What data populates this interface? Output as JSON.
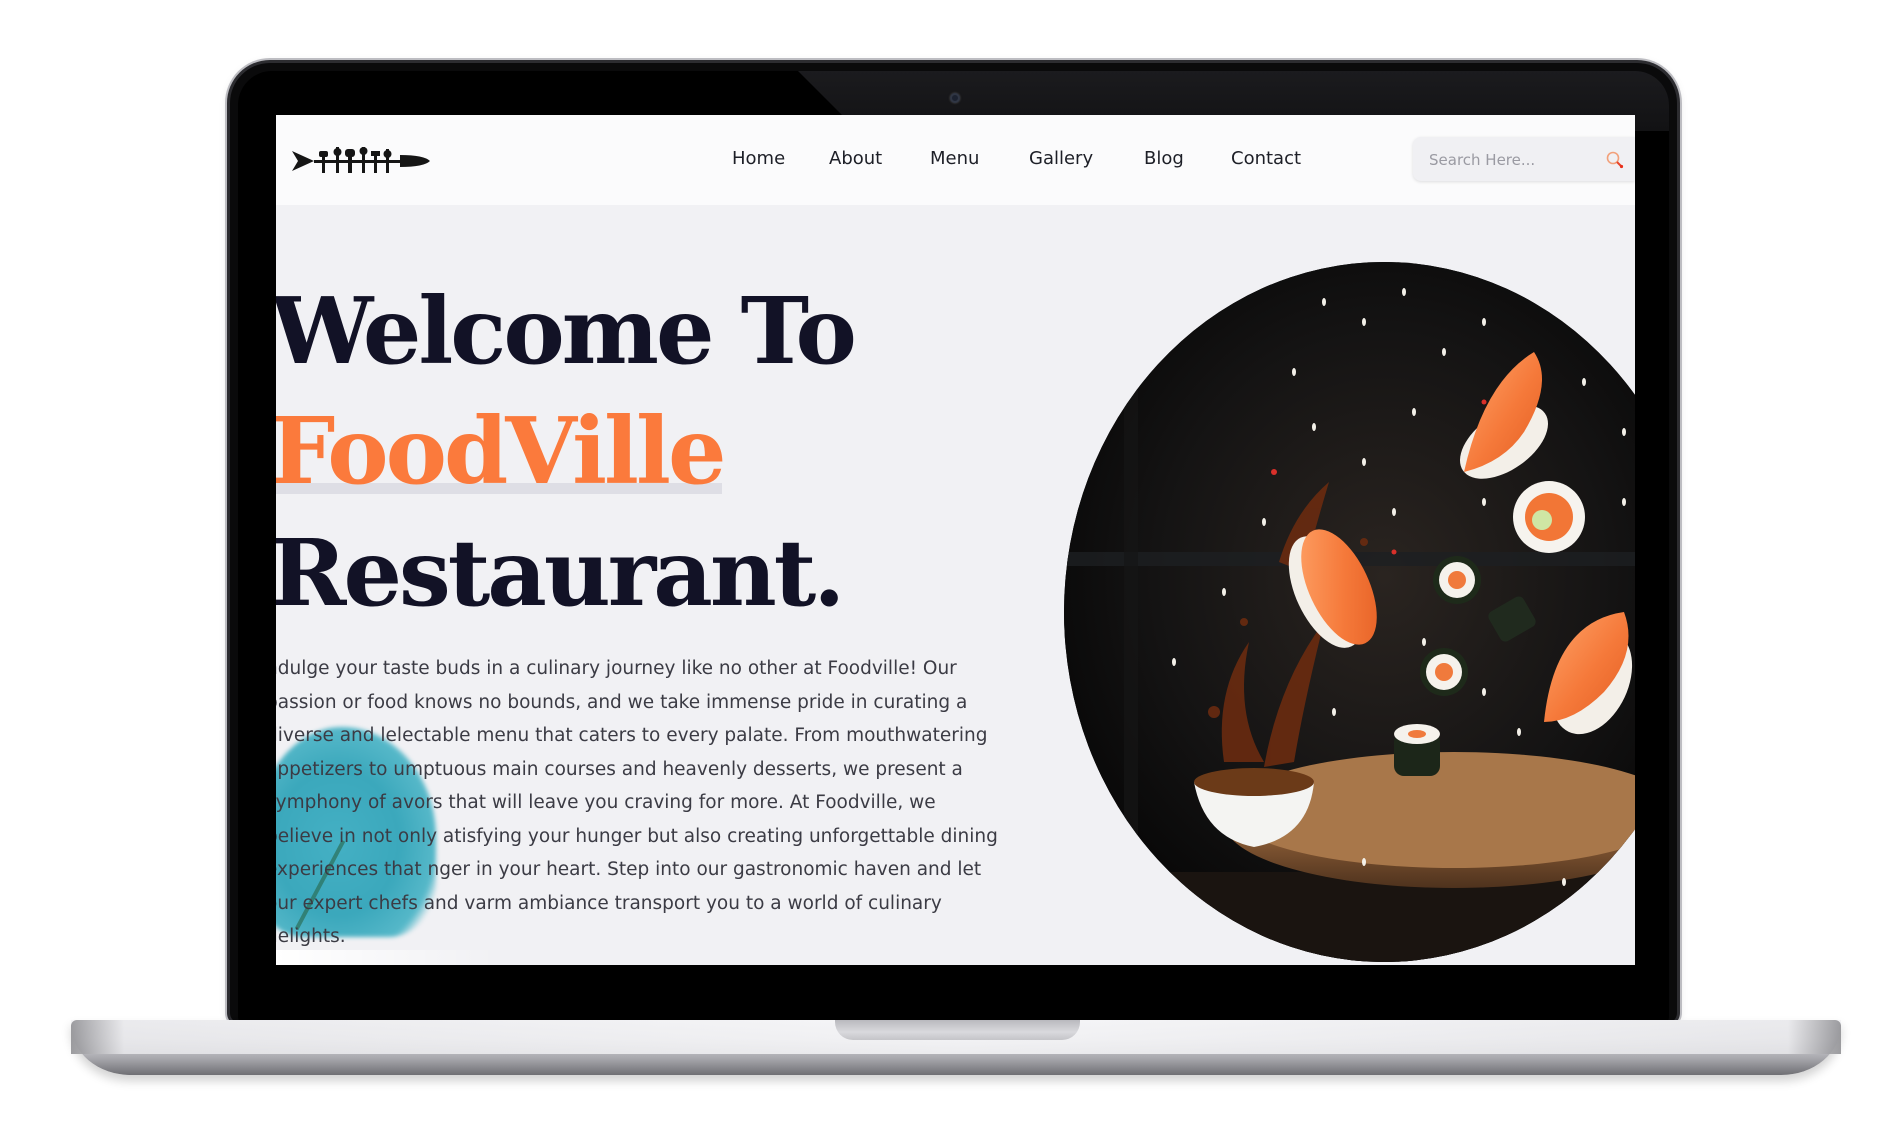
{
  "nav": {
    "items": [
      {
        "label": "Home"
      },
      {
        "label": "About"
      },
      {
        "label": "Menu"
      },
      {
        "label": "Gallery"
      },
      {
        "label": "Blog"
      },
      {
        "label": "Contact"
      }
    ],
    "search_placeholder": "Search Here..."
  },
  "hero": {
    "title_line1": "Welcome To",
    "title_line2": "FoodVille",
    "title_line3": "Restaurant.",
    "description": "ndulge your taste buds in a culinary journey like no other at Foodville! Our passion or food knows no bounds, and we take immense pride in curating a diverse and lelectable menu that caters to every palate. From mouthwatering appetizers to umptuous main courses and heavenly desserts, we present a symphony of avors that will leave you craving for more. At Foodville, we believe in not only atisfying your hunger but also creating unforgettable dining experiences that nger in your heart. Step into our gastronomic haven and let our expert chefs and varm ambiance transport you to a world of culinary delights."
  },
  "colors": {
    "accent": "#fb7a3c",
    "title": "#121226",
    "background": "#f1f1f4",
    "blob": "#3ba8bc"
  },
  "icons": {
    "logo": "cutlery-fish-logo",
    "search": "search-icon",
    "hero_image": "sushi-splash-image"
  }
}
